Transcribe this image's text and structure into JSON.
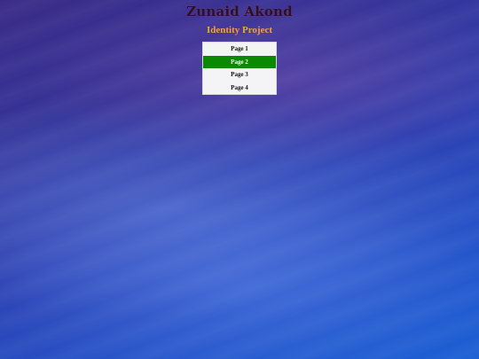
{
  "site": {
    "title": "Zunaid Akond",
    "subtitle": "Identity Project"
  },
  "nav": {
    "items": [
      {
        "label": "Page 1",
        "active": false
      },
      {
        "label": "Page 2",
        "active": true
      },
      {
        "label": "Page 3",
        "active": false
      },
      {
        "label": "Page 4",
        "active": false
      }
    ]
  },
  "colors": {
    "title": "#2c1120",
    "subtitle": "#f0a23a",
    "nav_bg": "#f4f4f6",
    "active_bg": "#0a8a00",
    "active_text": "#ffffff"
  }
}
